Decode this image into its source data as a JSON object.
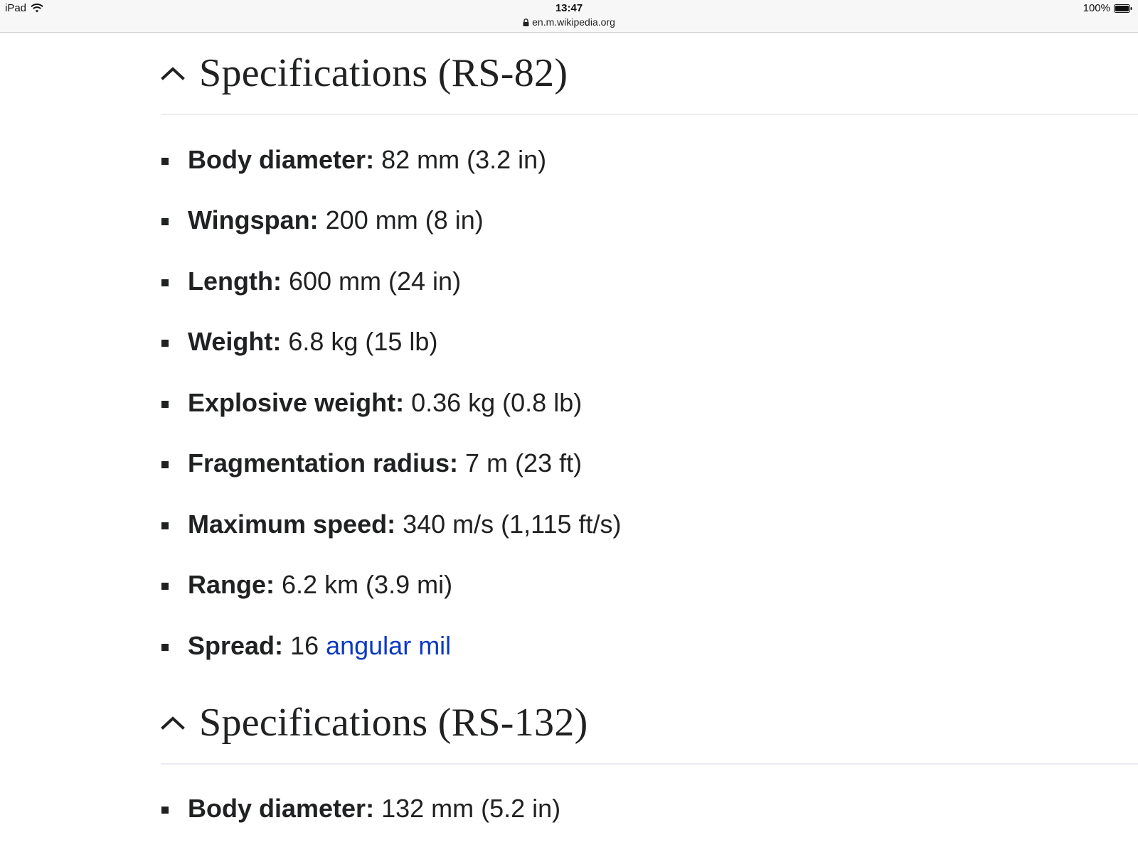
{
  "status_bar": {
    "device": "iPad",
    "time": "13:47",
    "url": "en.m.wikipedia.org",
    "battery": "100%"
  },
  "sections": [
    {
      "title": "Specifications (RS-82)",
      "items": [
        {
          "label": "Body diameter:",
          "value": " 82 mm (3.2 in)"
        },
        {
          "label": "Wingspan:",
          "value": " 200 mm (8 in)"
        },
        {
          "label": "Length:",
          "value": " 600 mm (24 in)"
        },
        {
          "label": "Weight:",
          "value": " 6.8 kg (15 lb)"
        },
        {
          "label": "Explosive weight:",
          "value": " 0.36 kg (0.8 lb)"
        },
        {
          "label": "Fragmentation radius:",
          "value": " 7 m (23 ft)"
        },
        {
          "label": "Maximum speed:",
          "value": " 340 m/s (1,115 ft/s)"
        },
        {
          "label": "Range:",
          "value": " 6.2 km (3.9 mi)"
        },
        {
          "label": "Spread:",
          "value": " 16 ",
          "link": "angular mil"
        }
      ]
    },
    {
      "title": "Specifications (RS-132)",
      "items": [
        {
          "label": "Body diameter:",
          "value": " 132 mm (5.2 in)"
        }
      ]
    }
  ]
}
